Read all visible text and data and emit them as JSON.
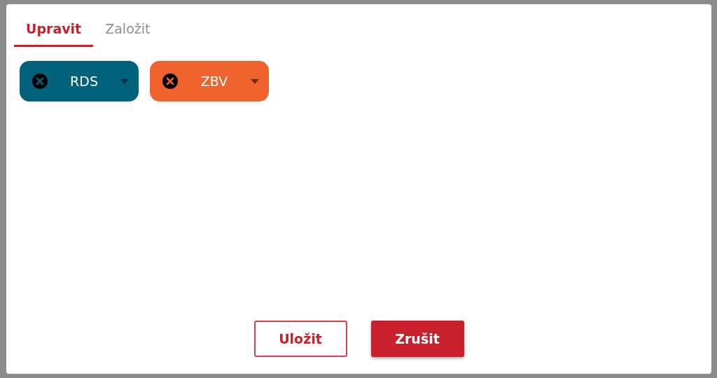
{
  "tabs": [
    {
      "label": "Upravit",
      "selected": true
    },
    {
      "label": "Založit",
      "selected": false
    }
  ],
  "chips": [
    {
      "label": "RDS",
      "color": "#00627a"
    },
    {
      "label": "ZBV",
      "color": "#f0622d"
    }
  ],
  "buttons": [
    {
      "label": "Uložit",
      "kind": "outline"
    },
    {
      "label": "Zrušit",
      "kind": "filled"
    }
  ]
}
